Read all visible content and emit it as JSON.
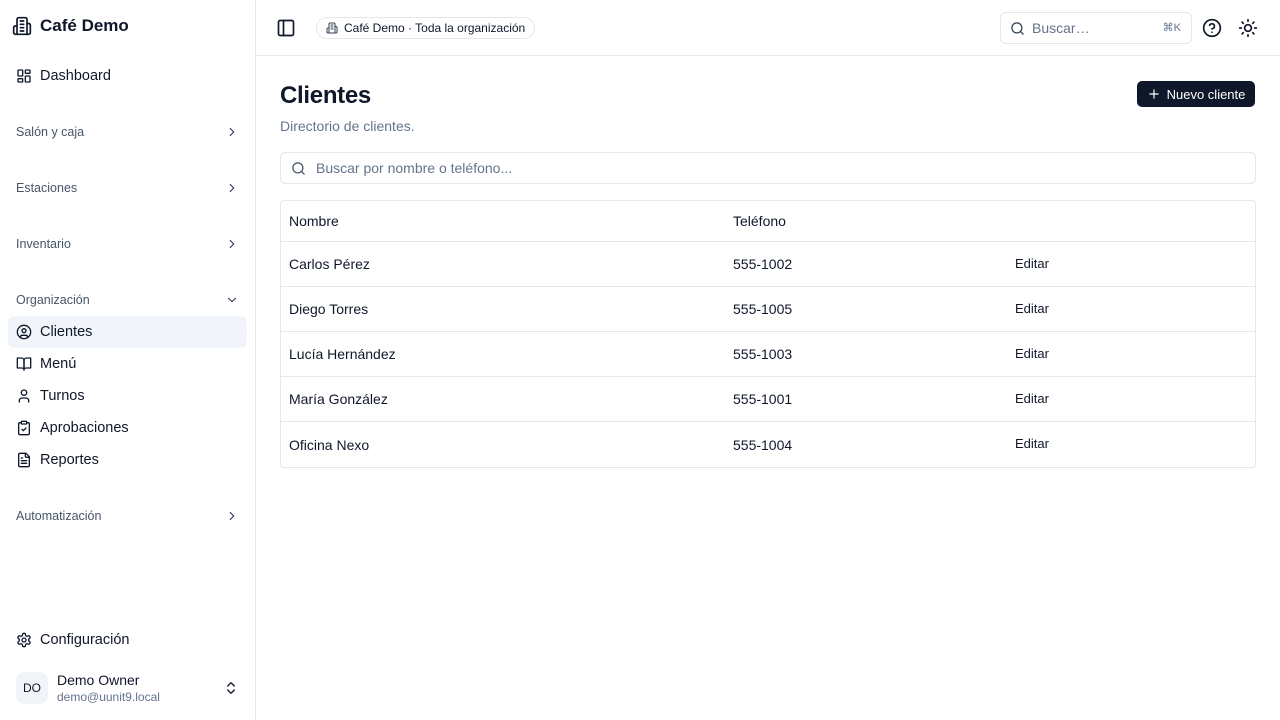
{
  "sidebar": {
    "brand": "Café Demo",
    "dashboard": "Dashboard",
    "groups": {
      "salon": "Salón y caja",
      "estaciones": "Estaciones",
      "inventario": "Inventario",
      "organizacion": "Organización",
      "automatizacion": "Automatización"
    },
    "org_items": {
      "clientes": "Clientes",
      "menu": "Menú",
      "turnos": "Turnos",
      "aprobaciones": "Aprobaciones",
      "reportes": "Reportes"
    },
    "settings": "Configuración",
    "user": {
      "initials": "DO",
      "name": "Demo Owner",
      "email": "demo@uunit9.local"
    }
  },
  "topbar": {
    "org_scope": "Café Demo · Toda la organización",
    "search_placeholder": "Buscar…",
    "shortcut": "⌘K"
  },
  "main": {
    "title": "Clientes",
    "subtitle": "Directorio de clientes.",
    "new_button": "Nuevo cliente",
    "filter_placeholder": "Buscar por nombre o teléfono...",
    "table": {
      "headers": {
        "name": "Nombre",
        "phone": "Teléfono"
      },
      "rows": [
        {
          "name": "Carlos Pérez",
          "phone": "555-1002",
          "action": "Editar"
        },
        {
          "name": "Diego Torres",
          "phone": "555-1005",
          "action": "Editar"
        },
        {
          "name": "Lucía Hernández",
          "phone": "555-1003",
          "action": "Editar"
        },
        {
          "name": "María González",
          "phone": "555-1001",
          "action": "Editar"
        },
        {
          "name": "Oficina Nexo",
          "phone": "555-1004",
          "action": "Editar"
        }
      ]
    }
  },
  "colors": {
    "primary": "#0f172a",
    "muted_text": "#64748b",
    "border": "#e5e7eb",
    "active_bg": "#f1f5f9"
  },
  "icons": {
    "brand": "building-icon",
    "dashboard": "layout-grid-icon",
    "clientes": "user-circle-icon",
    "menu": "book-open-icon",
    "turnos": "user-icon",
    "aprobaciones": "clipboard-check-icon",
    "reportes": "file-text-icon",
    "settings": "gear-icon",
    "sidebar_toggle": "panel-left-icon",
    "help": "help-circle-icon",
    "theme": "sun-icon",
    "search": "search-icon",
    "add": "plus-icon"
  }
}
